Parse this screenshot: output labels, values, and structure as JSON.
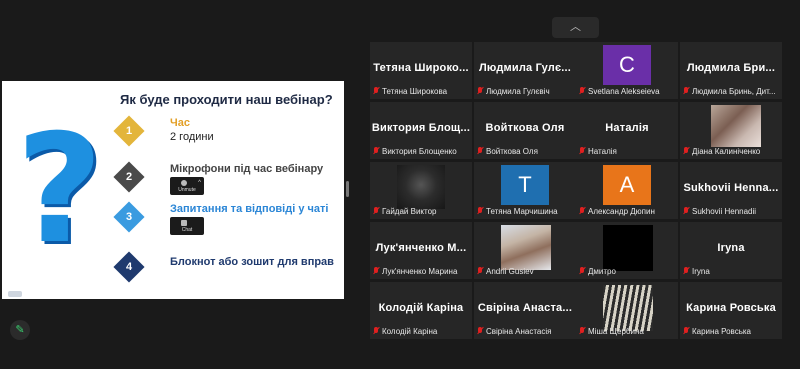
{
  "slide": {
    "title": "Як буде проходити наш вебінар?",
    "steps": [
      {
        "num": "1",
        "text": "Час",
        "sub": "2 години",
        "color": "#e3b53b",
        "text_color": "#e3a028"
      },
      {
        "num": "2",
        "text": "Мікрофони під час вебінару",
        "sub": "",
        "mini_label": "Unmute",
        "color": "#4a4a4a",
        "text_color": "#444444"
      },
      {
        "num": "3",
        "text": "Запитання та відповіді у чаті",
        "sub": "",
        "mini_label": "Chat",
        "color": "#3a9be0",
        "text_color": "#2b86d6"
      },
      {
        "num": "4",
        "text": "Блокнот або зошит для вправ",
        "sub": "",
        "color": "#1f3a6e",
        "text_color": "#1f3a6e"
      }
    ]
  },
  "controls": {
    "collapse_icon": "chevron-up",
    "collapse_glyph": "︿",
    "edit_glyph": "✎"
  },
  "participants": [
    {
      "name": "Тетяна  Широко...",
      "label": "Тетяна Широкова"
    },
    {
      "name": "Людмила  Гулє...",
      "label": "Людмила Гулєвіч"
    },
    {
      "avatar": "C",
      "avatar_color": "#6a2fa8",
      "label": "Svetlana Alekseieva"
    },
    {
      "name": "Людмила  Бри...",
      "label": "Людмила Бринь, Дит..."
    },
    {
      "name": "Виктория  Блощ...",
      "label": "Виктория Блощенко"
    },
    {
      "name": "Войткова  Оля",
      "label": "Войткова Оля"
    },
    {
      "name": "Наталія",
      "label": "Наталія"
    },
    {
      "photo": "cats",
      "label": "Діана Калиніченко"
    },
    {
      "photo": "cat-dark",
      "label": "Гайдай Виктор"
    },
    {
      "avatar": "T",
      "avatar_color": "#1f6fb0",
      "label": "Тетяна Марчишина"
    },
    {
      "avatar": "A",
      "avatar_color": "#e8751a",
      "label": "Александр Дюпин"
    },
    {
      "name": "Sukhovii  Henna...",
      "label": "Sukhovii Hennadii"
    },
    {
      "name": "Лук'янченко  М...",
      "label": "Лук'янченко Марина"
    },
    {
      "photo": "man",
      "label": "Andrii Gusiev"
    },
    {
      "photo": "black",
      "label": "Дмитро"
    },
    {
      "name": "Iryna",
      "label": "Iryna"
    },
    {
      "name": "Колодій  Каріна",
      "label": "Колодій Каріна"
    },
    {
      "name": "Свіріна  Анаста...",
      "label": "Свіріна Анастасія"
    },
    {
      "photo": "zebra",
      "label": "Міша Щербина"
    },
    {
      "name": "Карина  Ровська",
      "label": "Карина Ровська"
    }
  ]
}
